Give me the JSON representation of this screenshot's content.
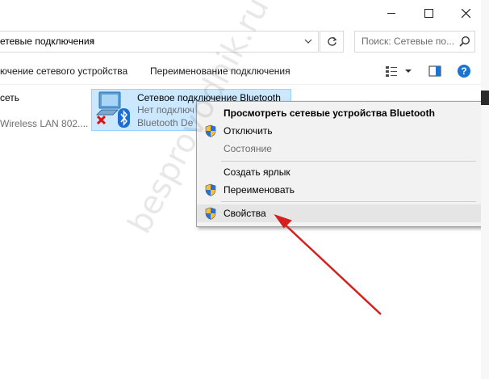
{
  "address": {
    "path": "етевые подключения",
    "chevron": "›"
  },
  "search": {
    "placeholder": "Поиск: Сетевые по..."
  },
  "commandbar": {
    "item1": "ючение сетевого устройства",
    "item2": "Переименование подключения"
  },
  "left_item": {
    "title": "сеть",
    "subtitle": "Wireless LAN 802...."
  },
  "selected_item": {
    "name": "Сетевое подключение Bluetooth",
    "status": "Нет подключ",
    "device": "Bluetooth Dev"
  },
  "context_menu": {
    "items": [
      {
        "label": "Просмотреть сетевые устройства Bluetooth"
      },
      {
        "label": "Отключить"
      },
      {
        "label": "Состояние"
      },
      {
        "label": "Создать ярлык"
      },
      {
        "label": "Переименовать"
      },
      {
        "label": "Свойства"
      }
    ]
  },
  "watermark": "besprovodnik.ru",
  "icons": {
    "minimize": "minimize-icon",
    "maximize": "maximize-icon",
    "close": "close-icon",
    "refresh": "refresh-icon",
    "search": "search-icon",
    "help": "help-icon",
    "shield": "uac-shield-icon",
    "bluetooth": "bluetooth-icon"
  },
  "colors": {
    "selection": "#cce8ff",
    "arrow": "#d62020",
    "help": "#1a74d1"
  },
  "help_label": "?"
}
